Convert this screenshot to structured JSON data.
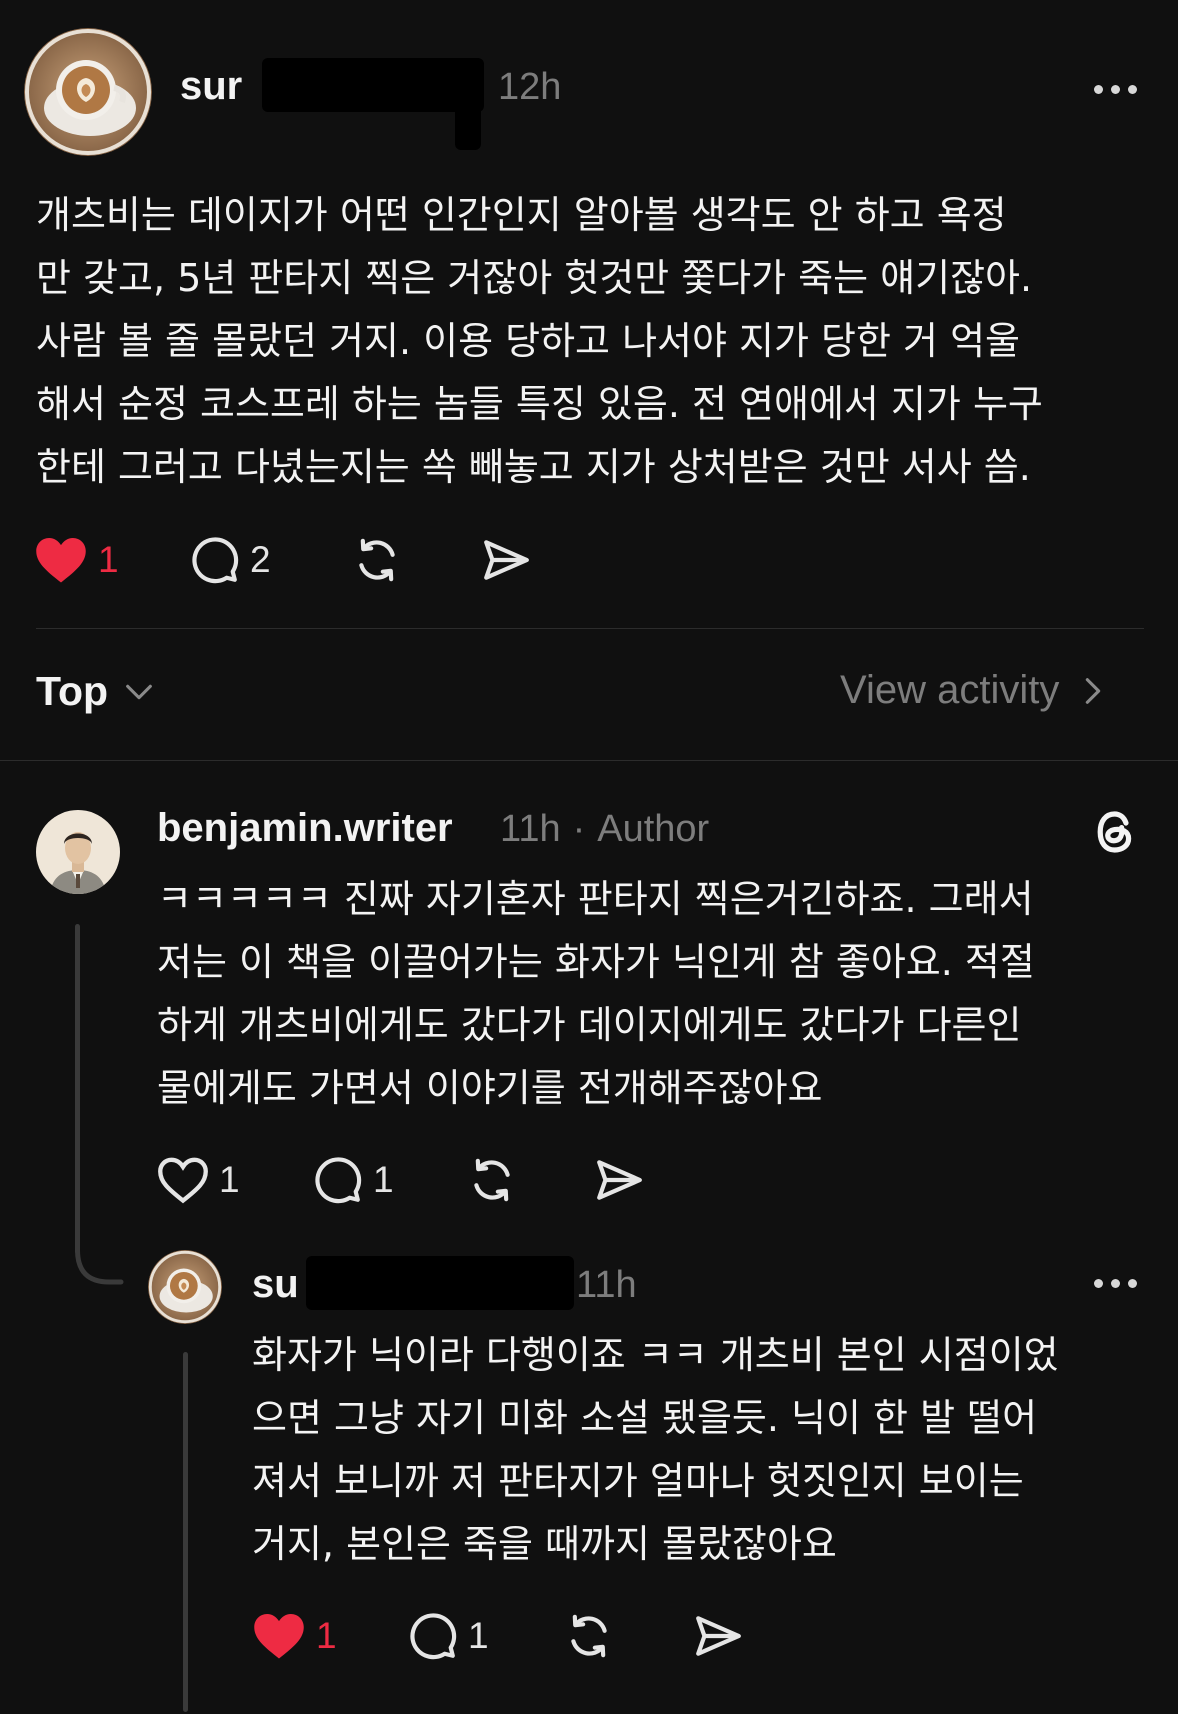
{
  "post": {
    "username": "sur",
    "time": "12h",
    "lines": [
      "개츠비는 데이지가 어떤 인간인지 알아볼 생각도 안 하고 욕정",
      "만 갖고, 5년 판타지 찍은 거잖아 헛것만 쫓다가 죽는 얘기잖아.",
      "사람 볼 줄 몰랐던 거지. 이용 당하고 나서야 지가 당한 거 억울",
      "해서 순정 코스프레 하는 놈들 특징 있음. 전 연애에서 지가 누구",
      "한테 그러고 다녔는지는 쏙 빼놓고 지가 상처받은 것만 서사 씀."
    ],
    "likes": "1",
    "replies": "2",
    "liked": true
  },
  "sort": {
    "label": "Top",
    "view_activity": "View activity"
  },
  "reply1": {
    "username": "benjamin.writer",
    "time": "11h",
    "separator": "·",
    "badge": "Author",
    "lines": [
      "ㅋㅋㅋㅋㅋ 진짜 자기혼자 판타지 찍은거긴하죠. 그래서",
      "저는 이 책을 이끌어가는 화자가 닉인게 참 좋아요. 적절",
      "하게 개츠비에게도 갔다가 데이지에게도 갔다가 다른인",
      "물에게도 가면서 이야기를 전개해주잖아요"
    ],
    "likes": "1",
    "replies": "1",
    "liked": false
  },
  "reply2": {
    "username": "su",
    "time": "11h",
    "lines": [
      "화자가 닉이라 다행이죠 ㅋㅋ 개츠비 본인 시점이었",
      "으면 그냥 자기 미화 소설 됐을듯. 닉이 한 발 떨어",
      "져서 보니까 저 판타지가 얼마나 헛짓인지 보이는",
      "거지, 본인은 죽을 때까지 몰랐잖아요"
    ],
    "likes": "1",
    "replies": "1",
    "liked": true
  },
  "colors": {
    "background": "#101010",
    "like_red": "#ee2b43",
    "muted": "#7d7d7d",
    "text": "#f3f3f3"
  },
  "icons": [
    "heart-icon",
    "comment-icon",
    "repost-icon",
    "share-icon",
    "more-icon",
    "threads-logo-icon",
    "chevron-down-icon",
    "chevron-right-icon"
  ]
}
